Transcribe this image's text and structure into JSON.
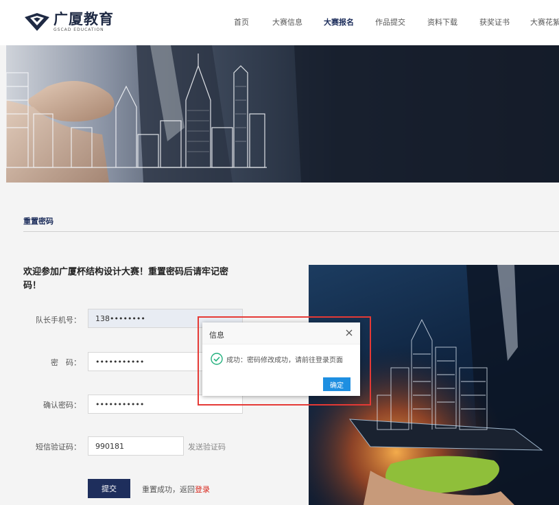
{
  "brand": {
    "name_cn": "广厦教育",
    "name_en": "GSCAD EDUCATION",
    "color": "#1f2a44"
  },
  "nav": {
    "items": [
      {
        "label": "首页",
        "active": false
      },
      {
        "label": "大赛信息",
        "active": false
      },
      {
        "label": "大赛报名",
        "active": true
      },
      {
        "label": "作品提交",
        "active": false
      },
      {
        "label": "资料下载",
        "active": false
      },
      {
        "label": "获奖证书",
        "active": false
      },
      {
        "label": "大赛花絮",
        "active": false
      }
    ]
  },
  "page": {
    "section_title": "重置密码",
    "welcome": "欢迎参加广厦杯结构设计大赛！重置密码后请牢记密码！"
  },
  "form": {
    "phone_label": "队长手机号：",
    "phone_value": "138••••••••",
    "password_label": "密　码：",
    "password_value": "•••••••••••",
    "confirm_label": "确认密码：",
    "confirm_value": "•••••••••••",
    "sms_label": "短信验证码：",
    "sms_value": "990181",
    "send_code": "发送验证码",
    "submit": "提交",
    "reset_note": "重置成功，返回",
    "login_link": "登录"
  },
  "dialog": {
    "title": "信息",
    "message": "成功：密码修改成功，请前往登录页面",
    "ok": "确定",
    "icon": "check-circle-icon",
    "accent": "#1e8fe1",
    "success_color": "#22b07d"
  },
  "highlight_color": "#e53935"
}
